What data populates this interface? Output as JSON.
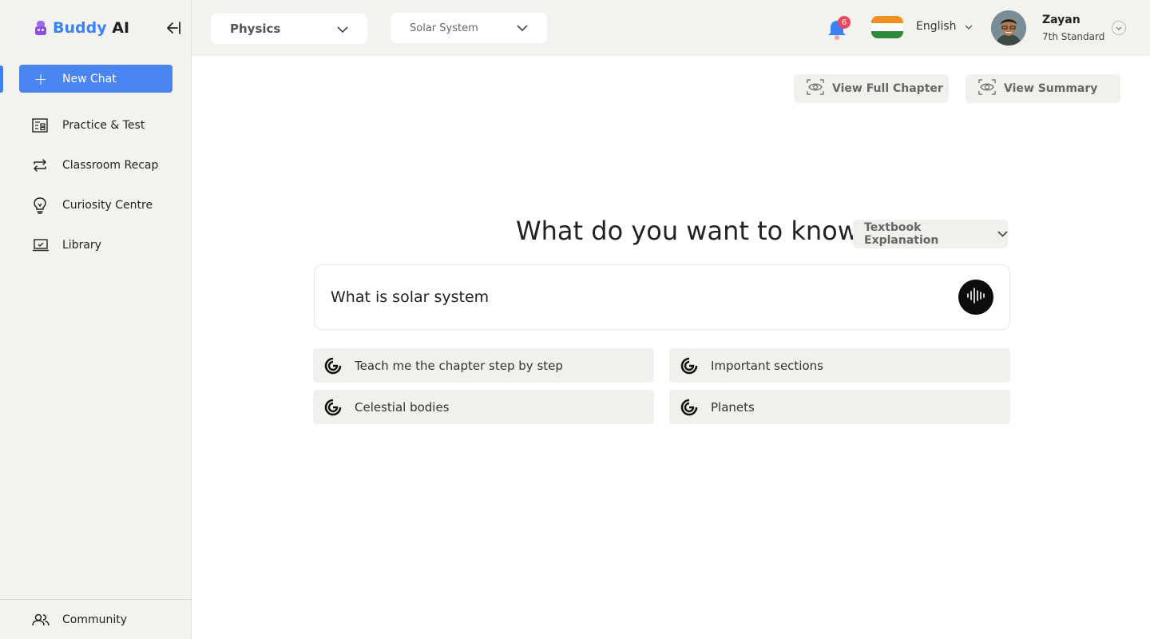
{
  "brand": {
    "part1": "Buddy",
    "part2": "AI"
  },
  "sidebar": {
    "new_chat_label": "New Chat",
    "items": [
      {
        "label": "Practice & Test",
        "icon": "practice-icon"
      },
      {
        "label": "Classroom Recap",
        "icon": "recap-icon"
      },
      {
        "label": "Curiosity Centre",
        "icon": "bulb-icon"
      },
      {
        "label": "Library",
        "icon": "laptop-icon"
      }
    ],
    "community_label": "Community"
  },
  "topbar": {
    "subject": "Physics",
    "chapter": "Solar System",
    "notification_count": "6",
    "language": "English",
    "user": {
      "name": "Zayan",
      "standard": "7th Standard"
    }
  },
  "main": {
    "view_full_chapter": "View Full Chapter",
    "view_summary": "View Summary",
    "question": "What do you want to know?",
    "mode": "Textbook Explanation",
    "input_value": "What is solar system",
    "suggestions": [
      "Teach me the chapter step by step",
      "Important sections",
      "Celestial bodies",
      "Planets"
    ]
  },
  "colors": {
    "accent": "#4a86f2",
    "badge": "#f0455b",
    "brand_purple": "#8b4fe0"
  }
}
